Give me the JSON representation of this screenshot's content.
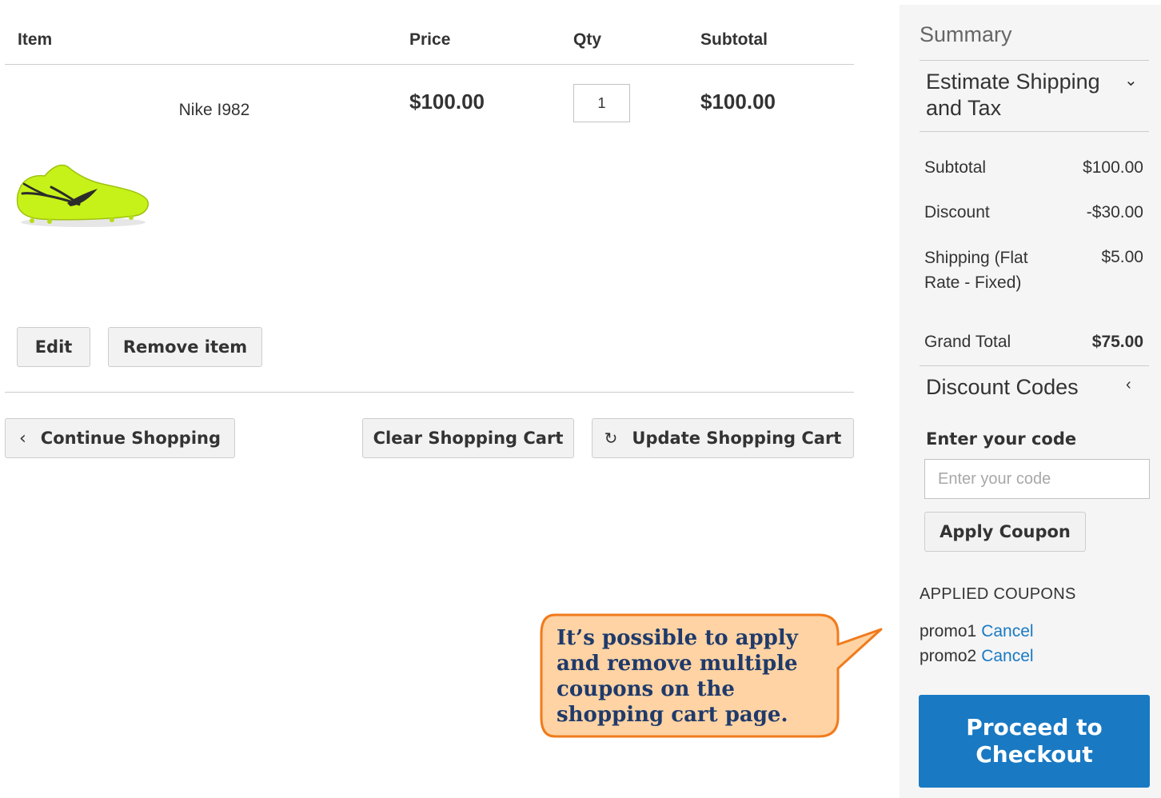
{
  "cart": {
    "headers": {
      "item": "Item",
      "price": "Price",
      "qty": "Qty",
      "subtotal": "Subtotal"
    },
    "item": {
      "name": "Nike I982",
      "image": "green-soccer-cleat",
      "price": "$100.00",
      "qty": "1",
      "subtotal": "$100.00",
      "edit_label": "Edit",
      "remove_label": "Remove item"
    },
    "actions": {
      "continue_label": "Continue Shopping",
      "clear_label": "Clear Shopping Cart",
      "update_label": "Update Shopping Cart"
    }
  },
  "summary": {
    "title": "Summary",
    "estimate_title": "Estimate Shipping and Tax",
    "totals": {
      "subtotal_label": "Subtotal",
      "subtotal_value": "$100.00",
      "discount_label": "Discount",
      "discount_value": "-$30.00",
      "shipping_label": "Shipping (Flat Rate - Fixed)",
      "shipping_value": "$5.00",
      "grand_label": "Grand Total",
      "grand_value": "$75.00"
    },
    "discount": {
      "title": "Discount Codes",
      "code_label": "Enter your code",
      "code_placeholder": "Enter your code",
      "apply_label": "Apply Coupon",
      "applied_title": "APPLIED COUPONS",
      "coupons": [
        {
          "code": "promo1",
          "cancel": "Cancel"
        },
        {
          "code": "promo2",
          "cancel": "Cancel"
        }
      ]
    },
    "checkout_label": "Proceed to Checkout"
  },
  "callout": {
    "text": "It’s possible to apply and remove multiple coupons on the shopping cart page.",
    "fill": "#ffd3a3",
    "border": "#f07b1d",
    "text_color": "#1f3a6b"
  },
  "colors": {
    "accent": "#1979c3",
    "sidebar_bg": "#f5f5f5"
  }
}
